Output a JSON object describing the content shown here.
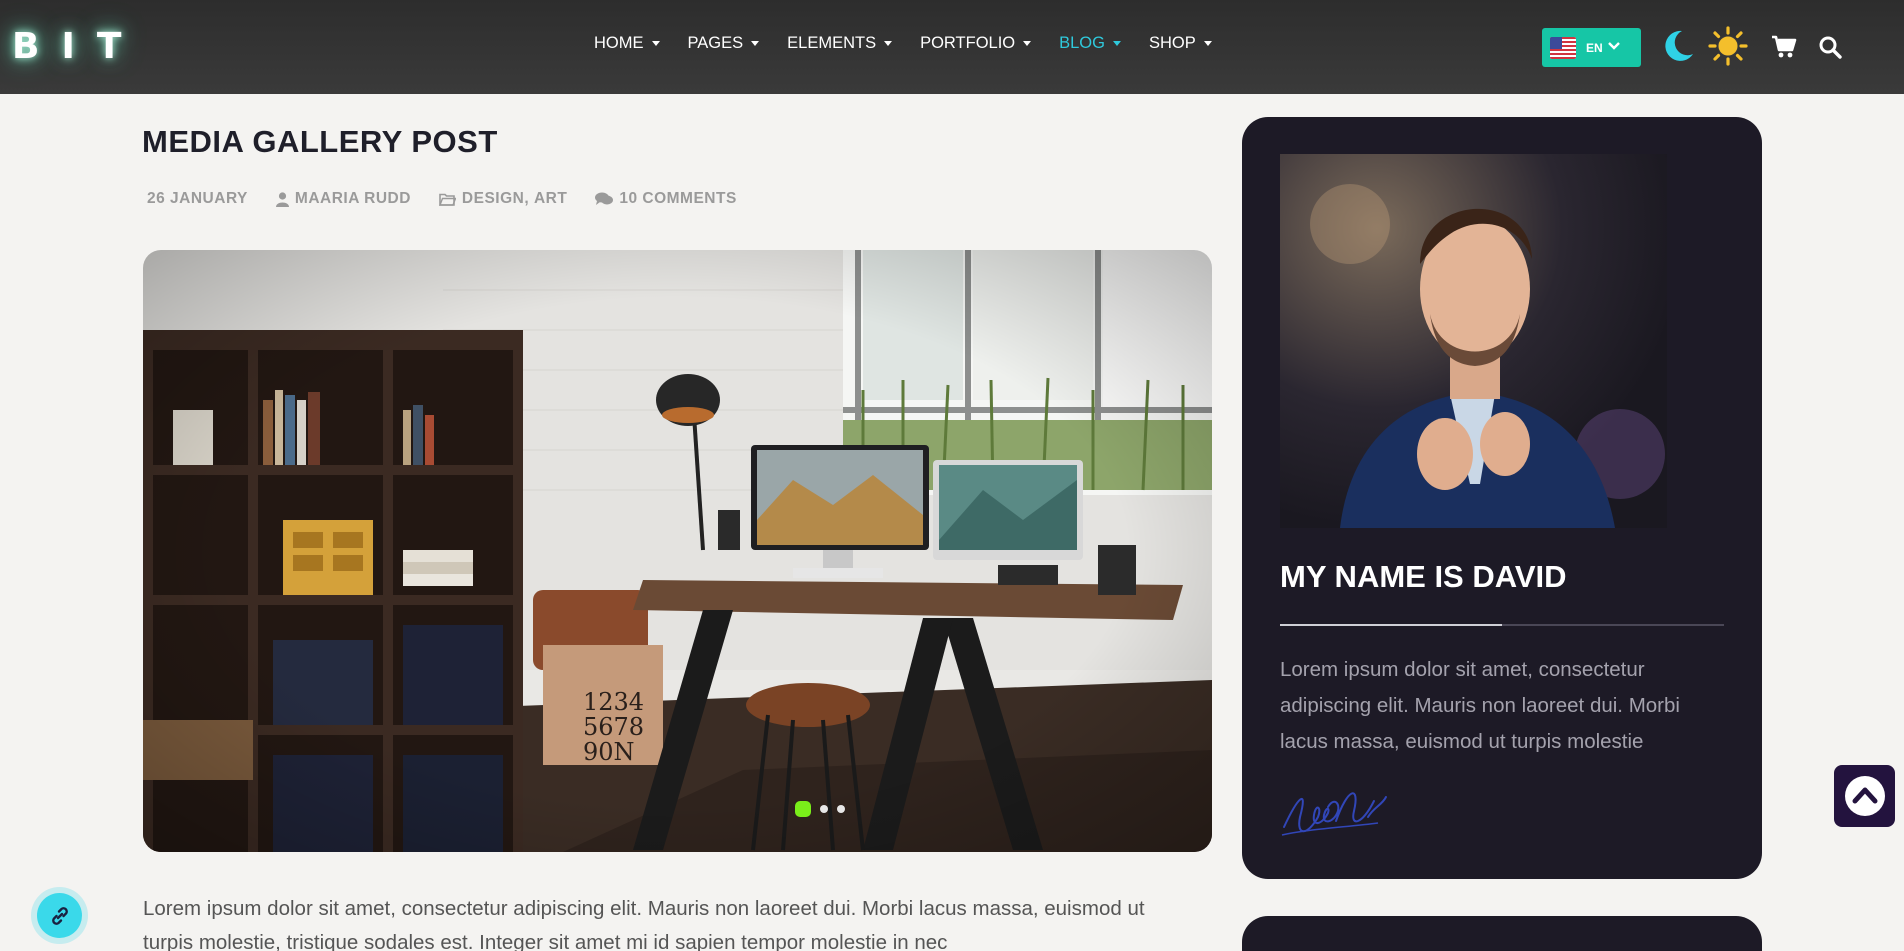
{
  "header": {
    "logo_text": "BIT",
    "nav": [
      {
        "label": "HOME",
        "active": false
      },
      {
        "label": "PAGES",
        "active": false
      },
      {
        "label": "ELEMENTS",
        "active": false
      },
      {
        "label": "PORTFOLIO",
        "active": false
      },
      {
        "label": "BLOG",
        "active": true
      },
      {
        "label": "SHOP",
        "active": false
      }
    ],
    "language": {
      "code": "EN",
      "flag": "us-flag-icon"
    },
    "icons": [
      "moon-icon",
      "sun-icon",
      "cart-icon",
      "search-icon"
    ],
    "accent_color": "#2fc9dc",
    "language_button_color": "#16c6a6"
  },
  "post": {
    "title": "MEDIA GALLERY POST",
    "meta": {
      "date": "26 JANUARY",
      "author": "MAARIA RUDD",
      "category_1": "DESIGN",
      "separator": ",",
      "category_2": "ART",
      "comments": "10 COMMENTS"
    },
    "gallery": {
      "slides_total": 3,
      "active_slide": 1,
      "active_dot_color": "#7aee1a"
    },
    "excerpt": "Lorem ipsum dolor sit amet, consectetur adipiscing elit. Mauris non laoreet dui. Morbi lacus massa, euismod ut turpis molestie, tristique sodales est. Integer sit amet mi id sapien tempor molestie in nec"
  },
  "sidebar": {
    "profile": {
      "name": "MY NAME IS DAVID",
      "bio": "Lorem ipsum dolor sit amet, consectetur adipiscing elit. Mauris non laoreet dui. Morbi lacus massa, euismod ut turpis molestie",
      "card_color": "#1d1a26"
    }
  },
  "floating": {
    "back_to_top_icon": "chevron-up-icon",
    "link_icon": "link-icon"
  }
}
